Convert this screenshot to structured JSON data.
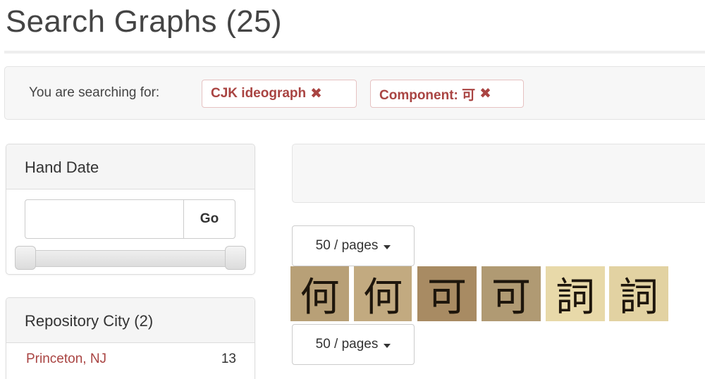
{
  "page": {
    "title": "Search Graphs (25)"
  },
  "search": {
    "label": "You are searching for:",
    "tags": [
      {
        "label": "CJK ideograph",
        "remove_icon": "✖"
      },
      {
        "label": "Component: 可",
        "remove_icon": "✖"
      }
    ]
  },
  "facets": {
    "hand_date": {
      "title": "Hand Date",
      "input_value": "",
      "go_label": "Go"
    },
    "repository_city": {
      "title": "Repository City (2)",
      "items": [
        {
          "label": "Princeton, NJ",
          "count": "13"
        }
      ]
    }
  },
  "pagination": {
    "top_label": "50 / pages",
    "bottom_label": "50 / pages"
  },
  "results": {
    "thumbnails": [
      {
        "glyph": "何",
        "bg": "#b8a077"
      },
      {
        "glyph": "何",
        "bg": "#c2aa80"
      },
      {
        "glyph": "可",
        "bg": "#a88b63"
      },
      {
        "glyph": "可",
        "bg": "#b09a73"
      },
      {
        "glyph": "詞",
        "bg": "#e8d9a9"
      },
      {
        "glyph": "詞",
        "bg": "#e2d2a2"
      }
    ]
  },
  "colors": {
    "accent_red": "#a94442",
    "panel_bg": "#f5f5f5"
  }
}
